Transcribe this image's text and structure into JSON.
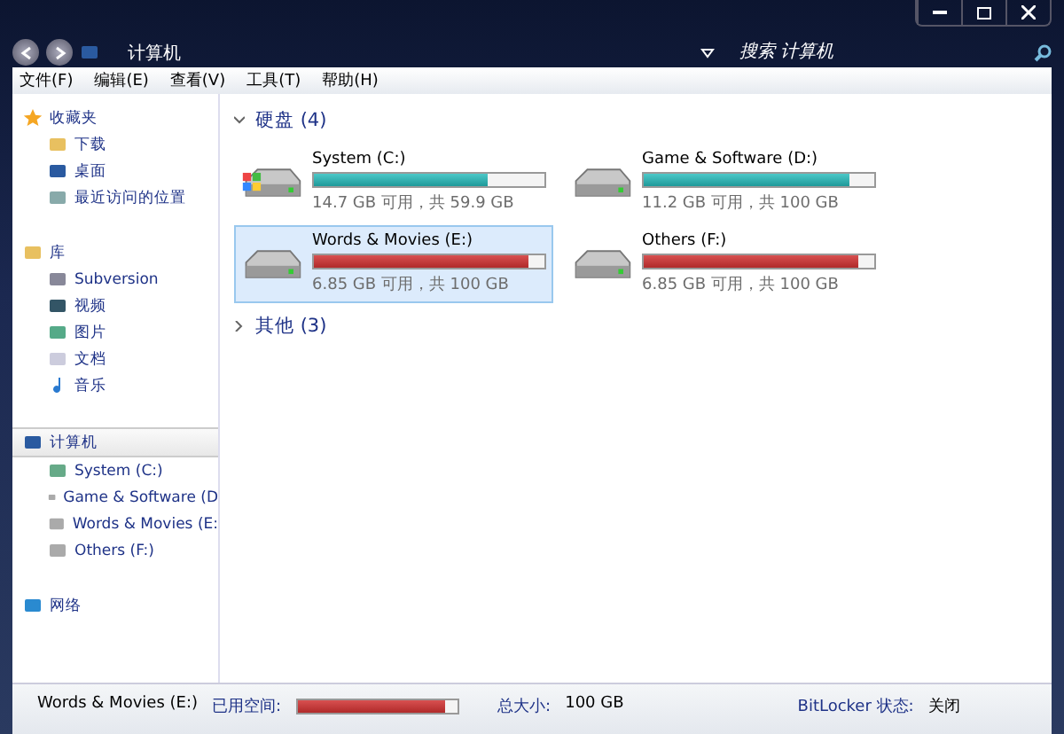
{
  "window": {
    "breadcrumb": [
      "计算机"
    ],
    "search": {
      "placeholder": "搜索 计算机"
    }
  },
  "menu": [
    "文件(F)",
    "编辑(E)",
    "查看(V)",
    "工具(T)",
    "帮助(H)"
  ],
  "sidebar": [
    {
      "label": "收藏夹",
      "selected": false,
      "children": [
        {
          "label": "下载"
        },
        {
          "label": "桌面"
        },
        {
          "label": "最近访问的位置"
        }
      ]
    },
    {
      "label": "库",
      "selected": false,
      "children": [
        {
          "label": "Subversion"
        },
        {
          "label": "视频"
        },
        {
          "label": "图片"
        },
        {
          "label": "文档"
        },
        {
          "label": "音乐"
        }
      ]
    },
    {
      "label": "计算机",
      "selected": true,
      "children": [
        {
          "label": "System (C:)"
        },
        {
          "label": "Game & Software (D"
        },
        {
          "label": "Words & Movies (E:"
        },
        {
          "label": "Others (F:)"
        }
      ]
    },
    {
      "label": "网络",
      "selected": false
    }
  ],
  "groups": [
    {
      "title": "硬盘 (4)",
      "expanded": true,
      "drives": [
        {
          "name": "System (C:)",
          "system": true,
          "level": 0.75,
          "full": false,
          "selected": false,
          "info": "14.7 GB 可用，共 59.9 GB"
        },
        {
          "name": "Game & Software (D:)",
          "system": false,
          "level": 0.89,
          "full": false,
          "selected": false,
          "info": "11.2 GB 可用，共 100 GB"
        },
        {
          "name": "Words & Movies (E:)",
          "system": false,
          "level": 0.93,
          "full": true,
          "selected": true,
          "info": "6.85 GB 可用，共 100 GB"
        },
        {
          "name": "Others (F:)",
          "system": false,
          "level": 0.93,
          "full": true,
          "selected": false,
          "info": "6.85 GB 可用，共 100 GB"
        }
      ]
    },
    {
      "title": "其他 (3)",
      "expanded": false
    }
  ],
  "details": {
    "name": "Words & Movies (E:)",
    "used_label": "已用空间:",
    "level": 0.93,
    "full": true,
    "size_label": "总大小:",
    "size": "100 GB",
    "bitlocker_label": "BitLocker 状态:",
    "bitlocker": "关闭"
  }
}
